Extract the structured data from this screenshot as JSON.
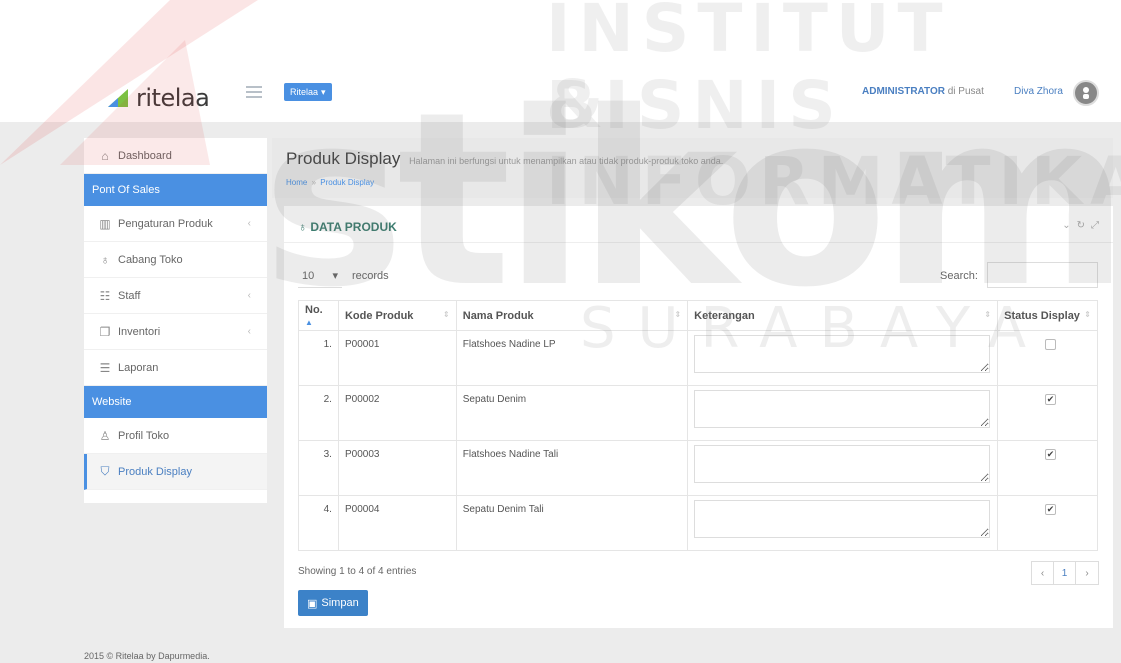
{
  "brand": {
    "logo_text": "ritelaa",
    "branch_button": "Ritelaa"
  },
  "header": {
    "role": "ADMINISTRATOR",
    "role_suffix": "di Pusat",
    "user_name": "Diva Zhora"
  },
  "sidebar": {
    "items": [
      {
        "label": "Dashboard"
      },
      {
        "label": "Pont Of Sales"
      },
      {
        "label": "Pengaturan Produk"
      },
      {
        "label": "Cabang Toko"
      },
      {
        "label": "Staff"
      },
      {
        "label": "Inventori"
      },
      {
        "label": "Laporan"
      },
      {
        "label": "Website"
      },
      {
        "label": "Profil Toko"
      },
      {
        "label": "Produk Display"
      }
    ]
  },
  "page": {
    "title": "Produk Display",
    "subtitle": "Halaman ini berfungsi untuk menampilkan atau tidak produk-produk toko anda.",
    "breadcrumb_home": "Home",
    "breadcrumb_sep": "»",
    "breadcrumb_current": "Produk Display"
  },
  "panel": {
    "title": "DATA PRODUK",
    "page_length": "10",
    "records_label": "records",
    "search_label": "Search:",
    "search_value": ""
  },
  "table": {
    "headers": [
      "No.",
      "Kode Produk",
      "Nama Produk",
      "Keterangan",
      "Status Display"
    ],
    "rows": [
      {
        "no": "1.",
        "kode": "P00001",
        "nama": "Flatshoes Nadine LP",
        "keterangan": "",
        "checked": false
      },
      {
        "no": "2.",
        "kode": "P00002",
        "nama": "Sepatu Denim",
        "keterangan": "",
        "checked": true
      },
      {
        "no": "3.",
        "kode": "P00003",
        "nama": "Flatshoes Nadine Tali",
        "keterangan": "",
        "checked": true
      },
      {
        "no": "4.",
        "kode": "P00004",
        "nama": "Sepatu Denim Tali",
        "keterangan": "",
        "checked": true
      }
    ]
  },
  "info": "Showing 1 to 4 of 4 entries",
  "pager": {
    "prev": "‹",
    "page": "1",
    "next": "›"
  },
  "save_button": "Simpan",
  "footer": "2015 © Ritelaa by Dapurmedia.",
  "watermark": {
    "line1": "INSTITUT BISNIS",
    "line2": "& INFORMATIKA",
    "big": "stikom",
    "small": "SURABAYA"
  },
  "colors": {
    "accent": "#4a90e2",
    "panel_title": "#3c7c6f",
    "logo_mark": "#e53935"
  }
}
